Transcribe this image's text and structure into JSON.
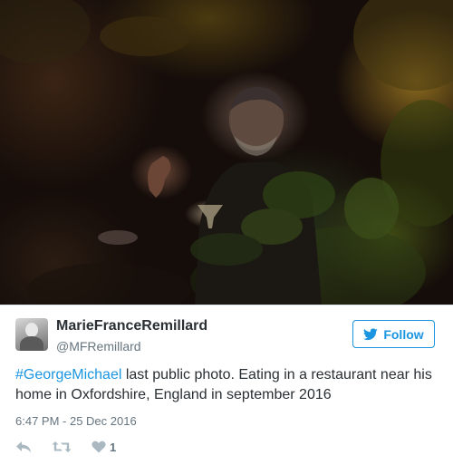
{
  "photo": {
    "alt": "Man seated at night in a restaurant garden, seen through foliage"
  },
  "tweet": {
    "author_name": "MarieFranceRemillard",
    "author_handle": "@MFRemillard",
    "follow_label": "Follow",
    "hashtag": "#GeorgeMichael",
    "text_rest": " last public photo. Eating in a restaurant near his home in Oxfordshire, England in september 2016",
    "timestamp": "6:47 PM - 25 Dec 2016",
    "like_count": "1"
  },
  "icons": {
    "follow": "twitter-bird-icon",
    "reply": "reply-icon",
    "retweet": "retweet-icon",
    "like": "heart-icon"
  },
  "colors": {
    "accent": "#1b95e0",
    "name": "#292f33",
    "muted": "#66757f",
    "action_icon": "#aab8c2"
  }
}
